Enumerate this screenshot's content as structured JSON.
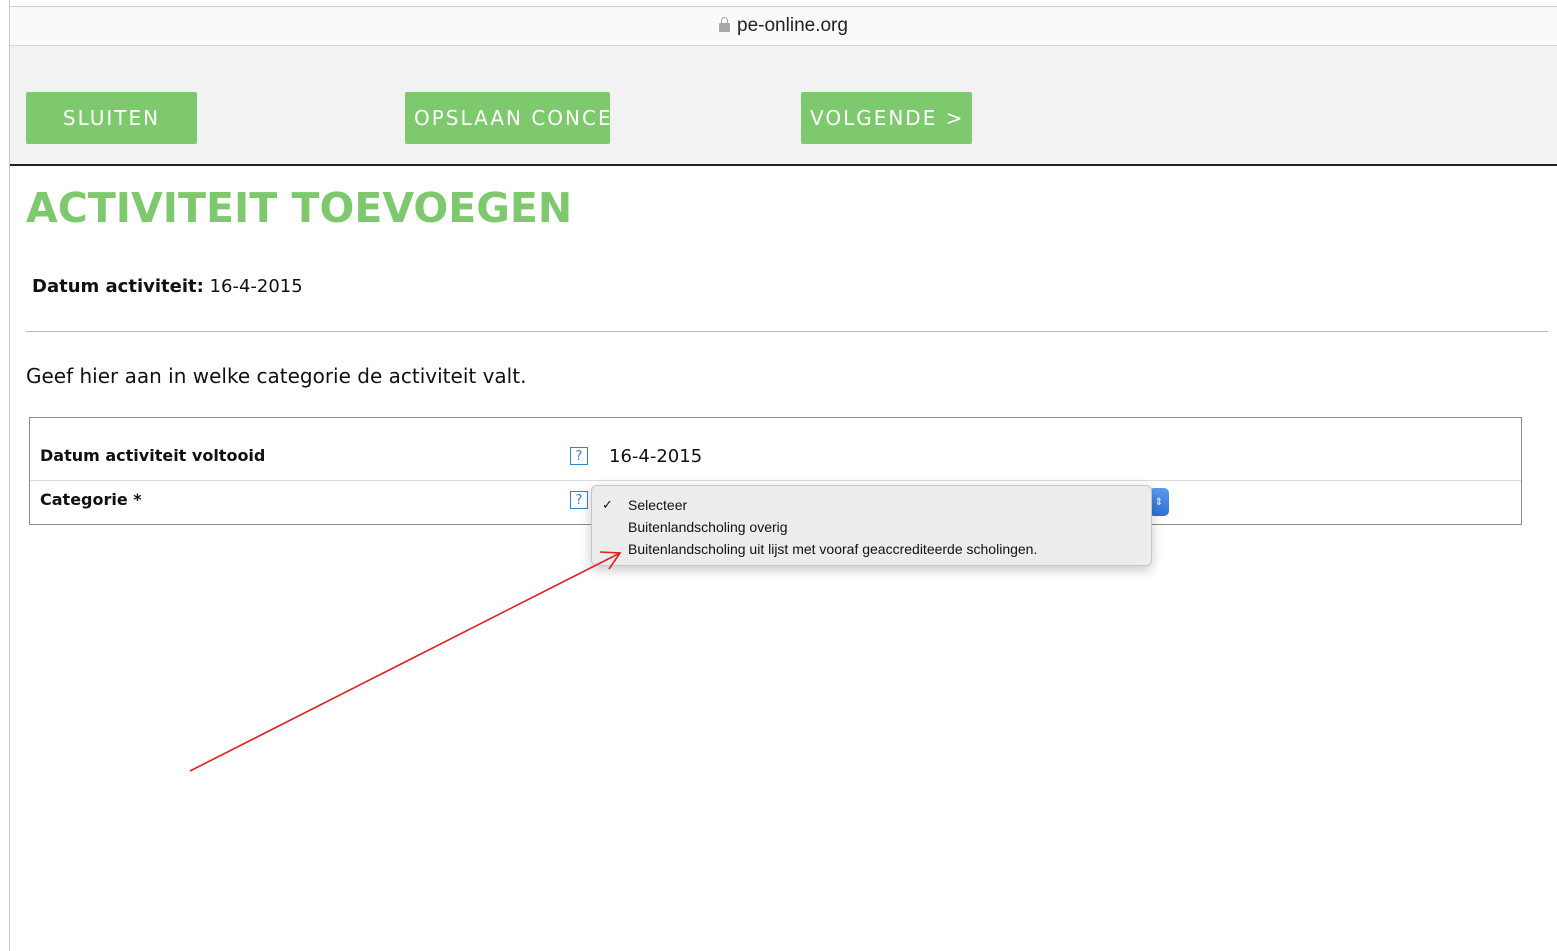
{
  "browser": {
    "url": "pe-online.org"
  },
  "toolbar": {
    "close_label": "SLUITEN",
    "save_label": "OPSLAAN CONCEPT",
    "next_label": "VOLGENDE >"
  },
  "page": {
    "title": "ACTIVITEIT TOEVOEGEN",
    "date_label": "Datum activiteit:",
    "date_value": "16-4-2015",
    "intro": "Geef hier aan in welke categorie de activiteit valt."
  },
  "form": {
    "row1_label": "Datum activiteit voltooid",
    "row1_value": "16-4-2015",
    "row2_label": "Categorie *",
    "help_glyph": "?"
  },
  "dropdown": {
    "check": "✓",
    "options": [
      "Selecteer",
      "Buitenlandscholing overig",
      "Buitenlandscholing uit lijst met vooraf geaccrediteerde scholingen."
    ]
  },
  "colors": {
    "accent": "#7ec86e",
    "annotation": "#e02020",
    "help": "#3a82c8"
  }
}
